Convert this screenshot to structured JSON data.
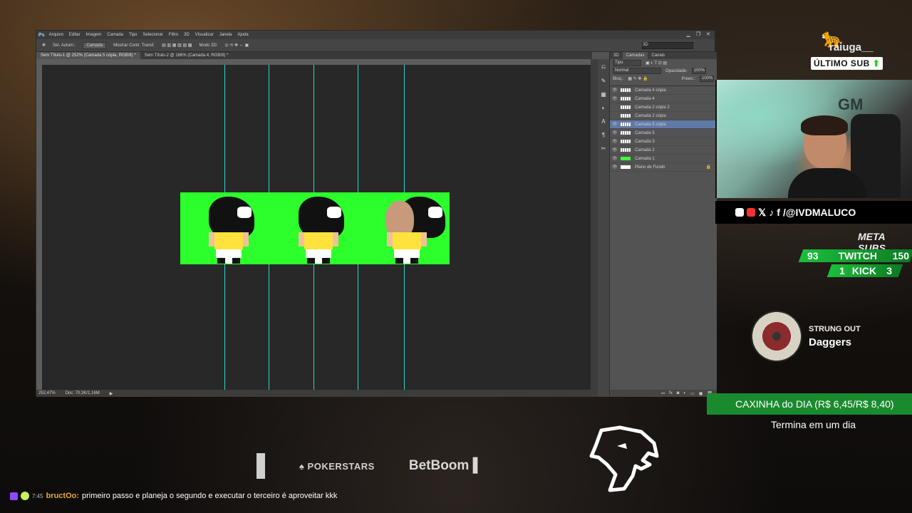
{
  "photoshop": {
    "logo": "Ps",
    "menu": [
      "Arquivo",
      "Editar",
      "Imagem",
      "Camada",
      "Tipo",
      "Selecionar",
      "Filtro",
      "3D",
      "Visualizar",
      "Janela",
      "Ajuda"
    ],
    "options": {
      "auto_select": "Sel. Autom.:",
      "layer_select": "Camada",
      "transform": "Mostrar Contr. Transf.",
      "mode_3d": "Modo 3D:",
      "workspace": "3D"
    },
    "tabs": [
      "Sem Título-1 @ 252% (Camada 5 cópia, RGB/8) *",
      "Sem Título-2 @ 166% (Camada 4, RGB/8) *"
    ],
    "status": {
      "zoom": "252,47%",
      "doc": "Doc: 70,3K/1,16M"
    },
    "panel": {
      "tabs": [
        "3D",
        "Camadas",
        "Canais"
      ],
      "filter": "Tipo",
      "blend": "Normal",
      "opacity_label": "Opacidade:",
      "opacity_value": "100%",
      "lock_label": "Bloq.:",
      "fill_label": "Preen.:",
      "fill_value": "100%",
      "layers": [
        {
          "name": "Camada 4 cópia",
          "thumb": "sprite"
        },
        {
          "name": "Camada 4",
          "thumb": "sprite"
        },
        {
          "name": "Camada 2 cópia 2",
          "thumb": "sprite"
        },
        {
          "name": "Camada 2 cópia",
          "thumb": "sprite"
        },
        {
          "name": "Camada 5 cópia",
          "thumb": "sprite",
          "selected": true
        },
        {
          "name": "Camada 5",
          "thumb": "sprite"
        },
        {
          "name": "Camada 3",
          "thumb": "sprite"
        },
        {
          "name": "Camada 2",
          "thumb": "sprite"
        },
        {
          "name": "Camada 1",
          "thumb": "green"
        },
        {
          "name": "Plano de Fundo",
          "thumb": "white",
          "locked": true
        }
      ]
    }
  },
  "overlay": {
    "sub_name": "raiuga__",
    "sub_label": "ÚLTIMO SUB",
    "social_handle": "/@IVDMALUCO",
    "meta_label": "META SUBS",
    "twitch": {
      "current": "93",
      "label": "TWITCH",
      "goal": "150"
    },
    "kick": {
      "current": "1",
      "label": "KICK",
      "goal": "3"
    },
    "music": {
      "artist": "STRUNG OUT",
      "title": "Daggers"
    },
    "caxinha": "CAXINHA do DIA (R$ 6,45/R$ 8,40)",
    "termina": "Termina em um dia",
    "sponsors": {
      "pokerstars": "POKERSTARS",
      "betboom": "BetBoom"
    },
    "chat": {
      "time": "7:45",
      "user": "bructOo:",
      "message": "primeiro passo e planeja o segundo e executar o terceiro é aproveitar kkk"
    }
  },
  "colors": {
    "brand_green": "#1bbf3c",
    "guide": "#2fd6c8",
    "canvas_green": "#2cff2c"
  }
}
